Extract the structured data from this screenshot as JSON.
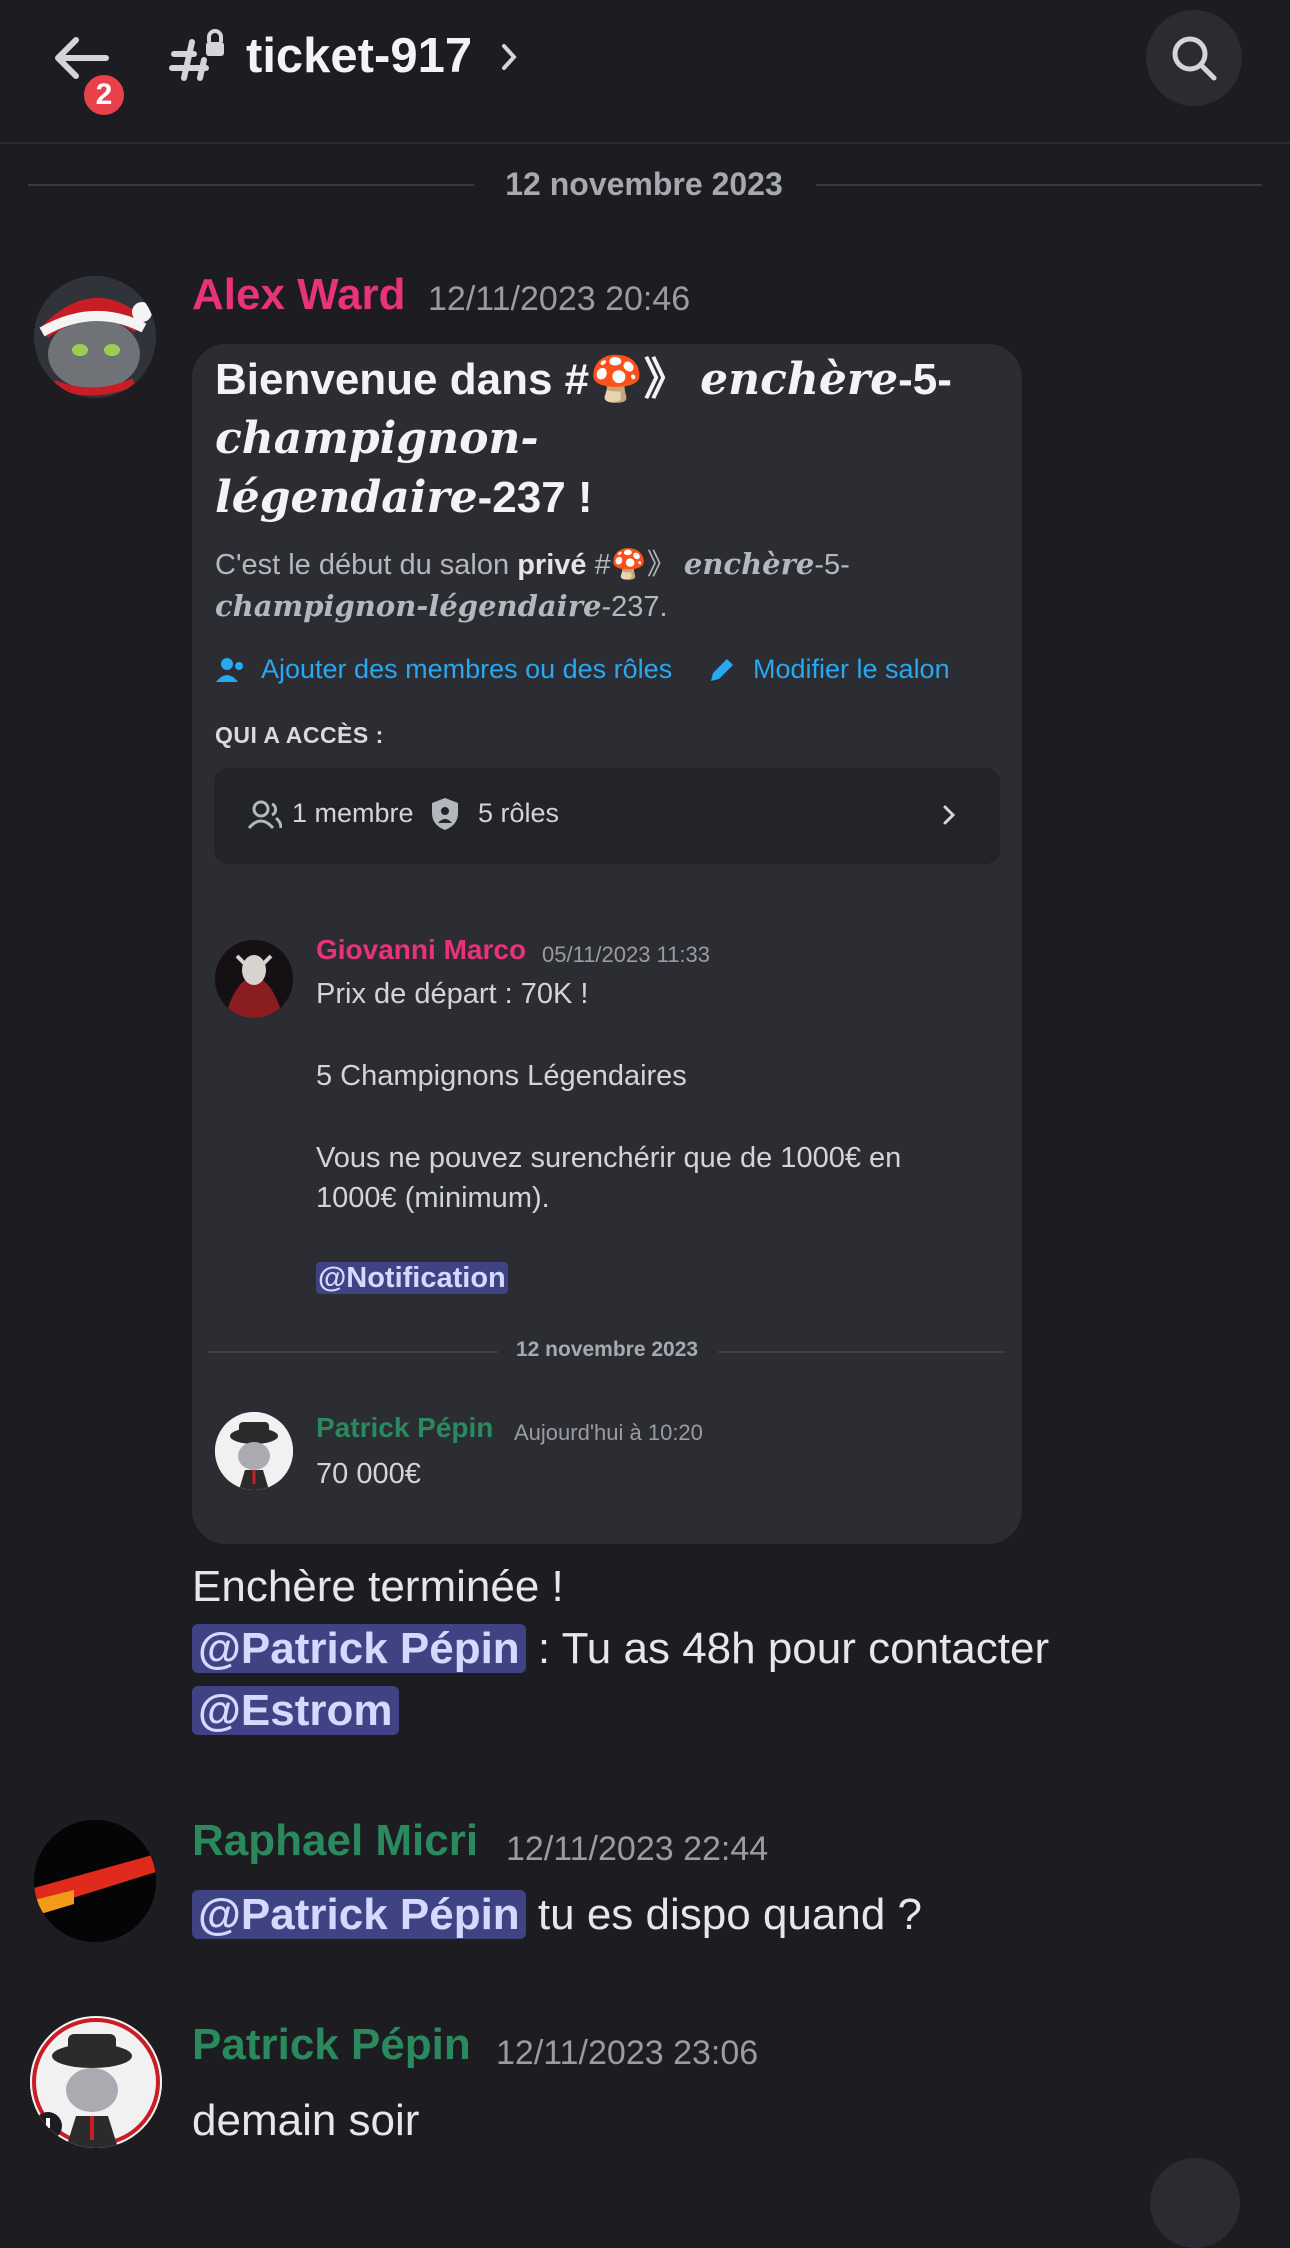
{
  "header": {
    "unread_badge": "2",
    "channel_name": "ticket-917"
  },
  "divider_top": "12 novembre 2023",
  "messages": [
    {
      "author": "Alex Ward",
      "author_color": "#e8327a",
      "timestamp": "12/11/2023 20:46",
      "embed": {
        "title_plain": "Bienvenue dans #🍄》",
        "title_fancy_1": "enchère",
        "title_rest_1": "-5-",
        "title_fancy_2": "champignon-",
        "title_fancy_3": "légendaire",
        "title_rest_2": "-237 !",
        "sub_1": "C'est le début du salon",
        "sub_bold": "privé",
        "sub_2": "#🍄》",
        "sub_fancy_1": "enchère",
        "sub_3": "-5-",
        "sub_fancy_2": "champignon-légendaire",
        "sub_4": "-237.",
        "add_members_label": "Ajouter des membres ou des rôles",
        "edit_channel_label": "Modifier le salon",
        "access_label": "QUI A ACCÈS :",
        "members_count": "1 membre",
        "roles_count": "5 rôles",
        "preview_1": {
          "author": "Giovanni Marco",
          "author_color": "#e8327a",
          "timestamp": "05/11/2023 11:33",
          "line_1": "Prix de départ : 70K !",
          "line_2": "5 Champignons Légendaires",
          "line_3": "Vous ne pouvez surenchérir que de 1000€ en",
          "line_4": "1000€ (minimum).",
          "mention": "@Notification"
        },
        "preview_divider": "12 novembre 2023",
        "preview_2": {
          "author": "Patrick Pépin",
          "author_color": "#2a8a5e",
          "timestamp": "Aujourd'hui à 10:20",
          "text": "70 000€"
        }
      },
      "line_1": "Enchère terminée !",
      "mention_1": "@Patrick Pépin",
      "line_2": " : Tu as 48h pour contacter",
      "mention_2": "@Estrom"
    },
    {
      "author": "Raphael Micri",
      "author_color": "#2a8a5e",
      "timestamp": "12/11/2023 22:44",
      "mention": "@Patrick Pépin",
      "text": " tu es dispo quand ?"
    },
    {
      "author": "Patrick Pépin",
      "author_color": "#2a8a5e",
      "timestamp": "12/11/2023 23:06",
      "text": "demain soir"
    }
  ]
}
